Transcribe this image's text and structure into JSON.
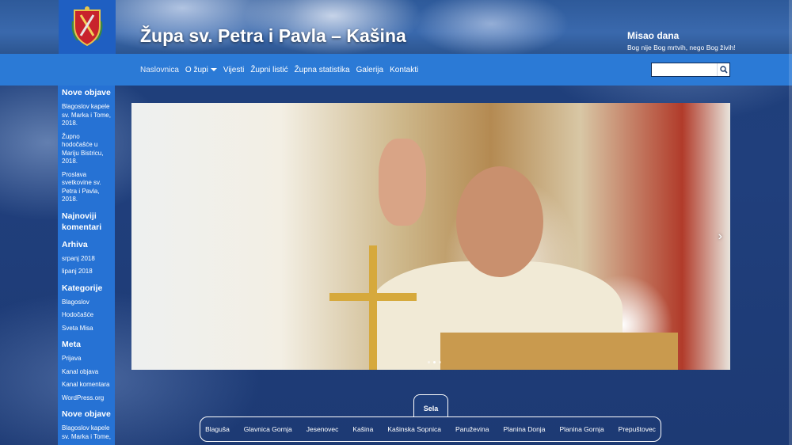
{
  "header": {
    "site_title": "Župa sv. Petra i Pavla – Kašina",
    "misao_title": "Misao dana",
    "misao_text": "Bog nije Bog mrtvih, nego Bog živih!"
  },
  "nav": {
    "items": [
      {
        "label": "Naslovnica",
        "has_dropdown": false
      },
      {
        "label": "O župi",
        "has_dropdown": true
      },
      {
        "label": "Vijesti",
        "has_dropdown": false
      },
      {
        "label": "Župni listić",
        "has_dropdown": false
      },
      {
        "label": "Župna statistika",
        "has_dropdown": false
      },
      {
        "label": "Galerija",
        "has_dropdown": false
      },
      {
        "label": "Kontakti",
        "has_dropdown": false
      }
    ],
    "search_value": "",
    "search_icon": "magnifier-icon"
  },
  "sidebar": {
    "sections": [
      {
        "heading": "Nove objave",
        "links": [
          "Blagoslov kapele sv. Marka i Tome, 2018.",
          "Župno hodočašće u Mariju Bistricu, 2018.",
          "Proslava svetkovine sv. Petra i Pavla, 2018."
        ]
      },
      {
        "heading": "Najnoviji komentari",
        "links": []
      },
      {
        "heading": "Arhiva",
        "links": [
          "srpanj 2018",
          "lipanj 2018"
        ]
      },
      {
        "heading": "Kategorije",
        "links": [
          "Blagoslov",
          "Hodočašće",
          "Sveta Misa"
        ]
      },
      {
        "heading": "Meta",
        "links": [
          "Prijava",
          "Kanal objava",
          "Kanal komentara",
          "WordPress.org"
        ]
      },
      {
        "heading": "Nove objave",
        "links": [
          "Blagoslov kapele sv. Marka i Tome,"
        ]
      }
    ]
  },
  "slider": {
    "next_arrow": "›",
    "slide_count": 3,
    "active_slide": 1
  },
  "sela": {
    "tab_label": "Sela",
    "items": [
      "Blaguša",
      "Glavnica Gornja",
      "Jesenovec",
      "Kašina",
      "Kašinska Sopnica",
      "Paruževina",
      "Planina Donja",
      "Planina Gornja",
      "Prepuštovec"
    ]
  },
  "colors": {
    "nav_bar": "#2b7ad6",
    "sidebar": "#2672d4",
    "logo_box": "#1f5fc2",
    "page_bg": "#1e3f7a"
  }
}
